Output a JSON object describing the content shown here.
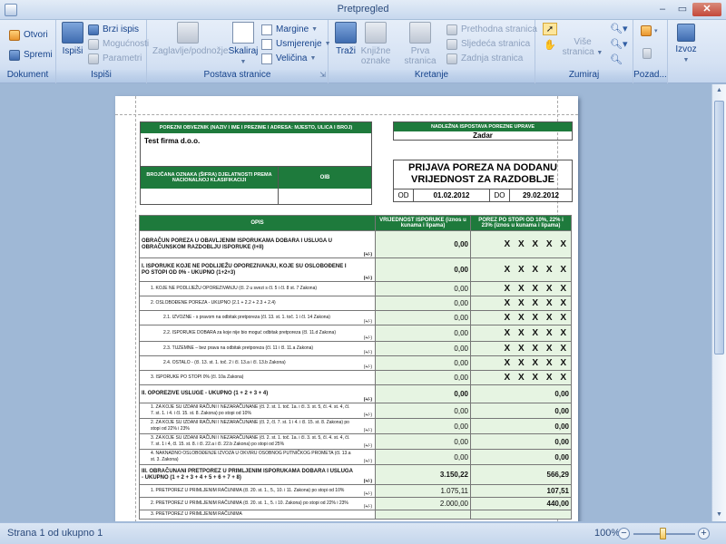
{
  "window": {
    "title": "Pretpregled",
    "close_glyph": "✕",
    "min_glyph": "–",
    "max_glyph": "▭"
  },
  "ribbon": {
    "dokument": {
      "label": "Dokument",
      "otvori": "Otvori",
      "spremi": "Spremi"
    },
    "ispisi_group": {
      "label": "Ispiši",
      "ispisi": "Ispiši",
      "brzi_ispis": "Brzi ispis",
      "mogucnosti": "Mogućnosti",
      "parametri": "Parametri"
    },
    "postava": {
      "label": "Postava stranice",
      "zaglavlje": "Zaglavlje/podnožje",
      "skaliraj": "Skaliraj",
      "margine": "Margine",
      "usmjerenje": "Usmjerenje",
      "velicina": "Veličina"
    },
    "kretanje": {
      "label": "Kretanje",
      "trazi": "Traži",
      "knjizne_1": "Knjižne",
      "knjizne_2": "oznake",
      "prva": "Prva stranica",
      "prethodna": "Prethodna stranica",
      "sljedeca": "Sljedeća stranica",
      "zadnja": "Zadnja stranica"
    },
    "zumiraj": {
      "label": "Zumiraj",
      "vise_stranica": "Više stranica"
    },
    "pozadina": {
      "label": "Pozad..."
    },
    "izvoz": {
      "label": "Izvoz"
    }
  },
  "form": {
    "obveznik_header": "POREZNI OBVEZNIK (NAZIV I IME I PREZIME I ADRESA: MJESTO, ULICA I BROJ)",
    "firma": "Test firma d.o.o.",
    "nkd_header": "BROJČANA OZNAKA (ŠIFRA) DJELATNOSTI PREMA NACIONALNOJ KLASIFIKACIJI",
    "oib_header": "OIB",
    "uprava_header": "NADLEŽNA ISPOSTAVA POREZNE UPRAVE",
    "uprava": "Zadar",
    "title_1": "PRIJAVA POREZA NA DODANU",
    "title_2": "VRIJEDNOST ZA RAZDOBLJE",
    "od_label": "OD",
    "od": "01.02.2012",
    "do_label": "DO",
    "do": "29.02.2012",
    "col_opis": "OPIS",
    "col_vrijednost": "VRIJEDNOST ISPORUKE (iznos u kunama i lipama)",
    "col_porez": "POREZ PO STOPI OD 10%, 22% i 23% (iznos u kunama i lipama)",
    "pm": "(+/-)",
    "rows": [
      {
        "text": "OBRAČUN POREZA U OBAVLJENIM ISPORUKAMA DOBARA I USLUGA U OBRAČUNSKOM RAZDOBLJU ISPORUKE (I+II)",
        "value": "0,00",
        "tax": "X X X X X"
      },
      {
        "text": "I. ISPORUKE KOJE NE PODLIJEŽU OPOREZIVANJU, KOJE SU OSLOBOĐENE I PO STOPI OD 0% - UKUPNO (1+2+3)",
        "value": "0,00",
        "tax": "X X X X X"
      },
      {
        "text": "1. KOJE NE PODLIJEŽU OPOREZIVANJU (čl. 2 u svezi s čl. 5 i čl. 8 st. 7 Zakona)",
        "value": "0,00",
        "tax": "X X X X X"
      },
      {
        "text": "2. OSLOBOĐENE POREZA - UKUPNO (2.1 + 2.2 + 2.3 + 2.4)",
        "value": "0,00",
        "tax": "X X X X X"
      },
      {
        "text": "2.1. IZVOZNE - s pravom na odbitak pretporeza (čl. 13. st. 1. toč. 1 i čl. 14 Zakona)",
        "value": "0,00",
        "tax": "X X X X X"
      },
      {
        "text": "2.2. ISPORUKE DOBARA za koje nije bio moguć odbitak pretporeza (čl. 11.d Zakona)",
        "value": "0,00",
        "tax": "X X X X X"
      },
      {
        "text": "2.3. TUZEMNE – bez prava na odbitak pretporeza (čl. 11 i čl. 11.a Zakona)",
        "value": "0,00",
        "tax": "X X X X X"
      },
      {
        "text": "2.4. OSTALO - (čl. 13. st. 1. toč. 2 i čl. 13.a i čl. 13.b Zakona)",
        "value": "0,00",
        "tax": "X X X X X"
      },
      {
        "text": "3. ISPORUKE PO STOPI 0% (čl. 10a Zakona)",
        "value": "0,00",
        "tax": "X X X X X"
      },
      {
        "text": "II. OPOREZIVE USLUGE - UKUPNO (1 + 2 + 3 + 4)",
        "value": "0,00",
        "tax": "0,00"
      },
      {
        "text": "1. ZA KOJE SU IZDANI RAČUNI I NEZARAČUNANE (čl. 2. st. 1. toč. 1a. i čl. 3. st. 5, čl. 4. st. 4, čl. 7. st. 1. i 4. i čl. 15. st. 8. Zakona) po stopi od 10%",
        "value": "0,00",
        "tax": "0,00"
      },
      {
        "text": "2. ZA KOJE SU IZDANI RAČUNI I NEZARAČUNANE (čl. 2, čl. 7. st. 1 i 4. i čl. 15. st. 8. Zakona) po stopi od 22% i 23%",
        "value": "0,00",
        "tax": "0,00"
      },
      {
        "text": "3. ZA KOJE SU IZDANI RAČUNI I NEZARAČUNANE (čl. 2. st. 1. toč. 1a. i čl. 3. st. 5, čl. 4. st. 4, čl. 7. st. 1 i 4, čl. 15. st. 8. i čl. 22.a i čl. 22.b Zakona) po stopi od 25%",
        "value": "0,00",
        "tax": "0,00"
      },
      {
        "text": "4. NAKNADNO OSLOBOĐENJE IZVOZA U OKVIRU OSOBNOG PUTNIČKOG PROMETA (čl. 13.a st. 3. Zakona)",
        "value": "0,00",
        "tax": "0,00"
      },
      {
        "text": "III. OBRAČUNANI PRETPOREZ U PRIMLJENIM ISPORUKAMA DOBARA I USLUGA - UKUPNO (1 + 2 + 3 + 4 + 5 + 6 + 7 + 8)",
        "value": "3.150,22",
        "tax": "566,29"
      },
      {
        "text": "1. PRETPOREZ U PRIMLJENIM RAČUNIMA (čl. 20. st. 1., 5., 10. i 11. Zakona) po stopi od 10%",
        "value": "1.075,11",
        "tax": "107,51"
      },
      {
        "text": "2. PRETPOREZ U PRIMLJENIM RAČUNIMA (čl. 20. st. 1., 5. i 10. Zakona) po stopi od 22% i 23%",
        "value": "2.000,00",
        "tax": "440,00"
      },
      {
        "text": "3. PRETPOREZ U PRIMLJENIM RAČUNIMA",
        "value": "",
        "tax": ""
      }
    ]
  },
  "status": {
    "page": "Strana 1 od ukupno 1",
    "zoom": "100%",
    "zoom_minus": "−",
    "zoom_plus": "+"
  }
}
